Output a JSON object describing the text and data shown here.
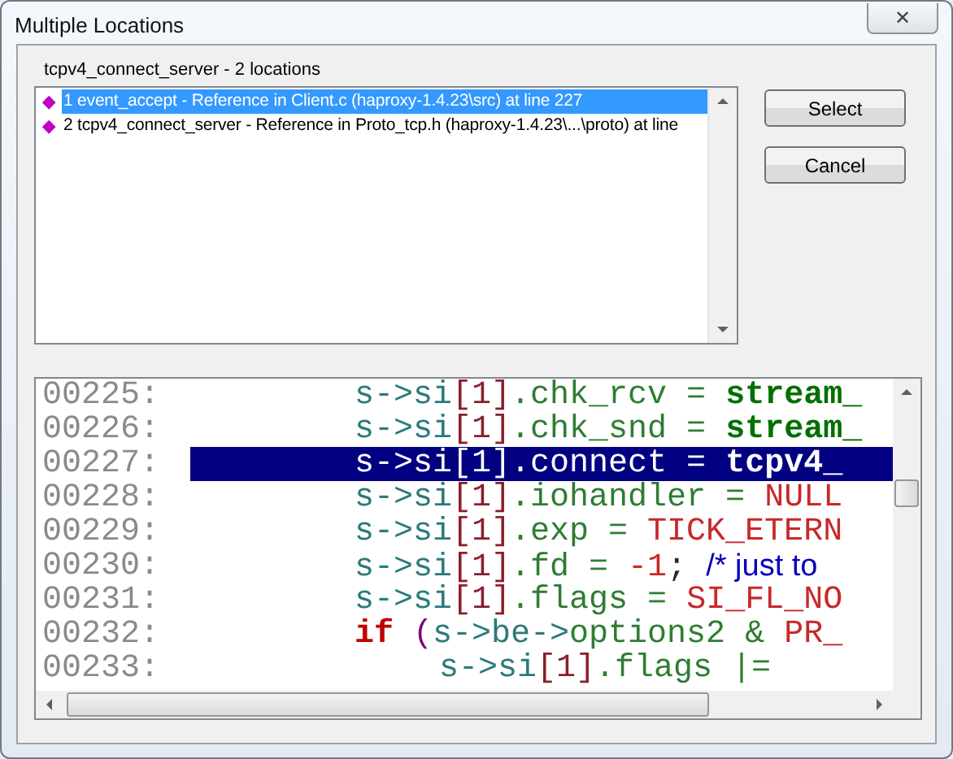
{
  "window": {
    "title": "Multiple Locations",
    "close": "✕"
  },
  "group_label": "tcpv4_connect_server - 2 locations",
  "locations": [
    {
      "marker": "◆",
      "text": "1 event_accept - Reference in Client.c (haproxy-1.4.23\\src) at line 227",
      "selected": true
    },
    {
      "marker": "◆",
      "text": "2 tcpv4_connect_server - Reference in Proto_tcp.h (haproxy-1.4.23\\...\\proto) at line",
      "selected": false
    }
  ],
  "buttons": [
    "Select",
    "Cancel"
  ],
  "code": [
    {
      "number": "00225:",
      "selected": false,
      "tokens": [
        {
          "kind": "ident",
          "text": "s->si"
        },
        {
          "kind": "index",
          "text": "[1]"
        },
        {
          "kind": "member",
          "text": ".chk_rcv = "
        },
        {
          "kind": "func",
          "text": "stream_"
        }
      ]
    },
    {
      "number": "00226:",
      "selected": false,
      "tokens": [
        {
          "kind": "ident",
          "text": "s->si"
        },
        {
          "kind": "index",
          "text": "[1]"
        },
        {
          "kind": "member",
          "text": ".chk_snd = "
        },
        {
          "kind": "func",
          "text": "stream_"
        }
      ]
    },
    {
      "number": "00227:",
      "selected": true,
      "tokens": [
        {
          "kind": "ident",
          "text": "s->si"
        },
        {
          "kind": "index",
          "text": "[1]"
        },
        {
          "kind": "member",
          "text": ".connect = "
        },
        {
          "kind": "func",
          "text": "tcpv4_"
        }
      ]
    },
    {
      "number": "00228:",
      "selected": false,
      "tokens": [
        {
          "kind": "ident",
          "text": "s->si"
        },
        {
          "kind": "index",
          "text": "[1]"
        },
        {
          "kind": "member",
          "text": ".iohandler = "
        },
        {
          "kind": "const",
          "text": "NULL"
        }
      ]
    },
    {
      "number": "00229:",
      "selected": false,
      "tokens": [
        {
          "kind": "ident",
          "text": "s->si"
        },
        {
          "kind": "index",
          "text": "[1]"
        },
        {
          "kind": "member",
          "text": ".exp = "
        },
        {
          "kind": "const",
          "text": "TICK_ETERN"
        }
      ]
    },
    {
      "number": "00230:",
      "selected": false,
      "tokens": [
        {
          "kind": "ident",
          "text": "s->si"
        },
        {
          "kind": "index",
          "text": "[1]"
        },
        {
          "kind": "member",
          "text": ".fd = "
        },
        {
          "kind": "const",
          "text": "-1"
        },
        {
          "kind": "punct",
          "text": "; "
        },
        {
          "kind": "comment",
          "text": "/* just to"
        }
      ]
    },
    {
      "number": "00231:",
      "selected": false,
      "tokens": [
        {
          "kind": "ident",
          "text": "s->si"
        },
        {
          "kind": "index",
          "text": "[1]"
        },
        {
          "kind": "member",
          "text": ".flags = "
        },
        {
          "kind": "const",
          "text": "SI_FL_NO"
        }
      ]
    },
    {
      "number": "00232:",
      "selected": false,
      "tokens": [
        {
          "kind": "keyword",
          "text": "if"
        },
        {
          "kind": "paren",
          "text": " ("
        },
        {
          "kind": "ident",
          "text": "s->be->"
        },
        {
          "kind": "member",
          "text": "options2 & "
        },
        {
          "kind": "const",
          "text": "PR_"
        }
      ],
      "children": [
        {
          "number": "00233:",
          "selected": false,
          "tokens": [
            {
              "kind": "ident",
              "text": "s->si"
            },
            {
              "kind": "index",
              "text": "[1]"
            },
            {
              "kind": "member",
              "text": ".flags |= "
            }
          ]
        }
      ]
    }
  ]
}
